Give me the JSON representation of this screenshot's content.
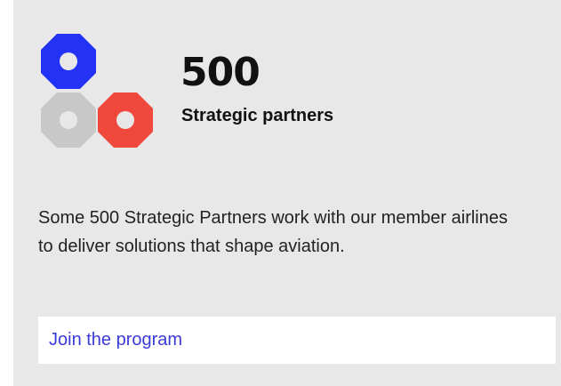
{
  "stat": {
    "value": "500",
    "label": "Strategic partners"
  },
  "description": "Some 500 Strategic Partners work with our member airlines to deliver solutions that shape aviation.",
  "cta": {
    "label": "Join the program"
  },
  "colors": {
    "card_background": "#e8e8e8",
    "logo_blue": "#2432f5",
    "logo_grey": "#c8c8c8",
    "logo_red": "#f0483c",
    "link": "#3a3ad8"
  },
  "icons": {
    "logo": "octagon-rings-logo-icon"
  }
}
